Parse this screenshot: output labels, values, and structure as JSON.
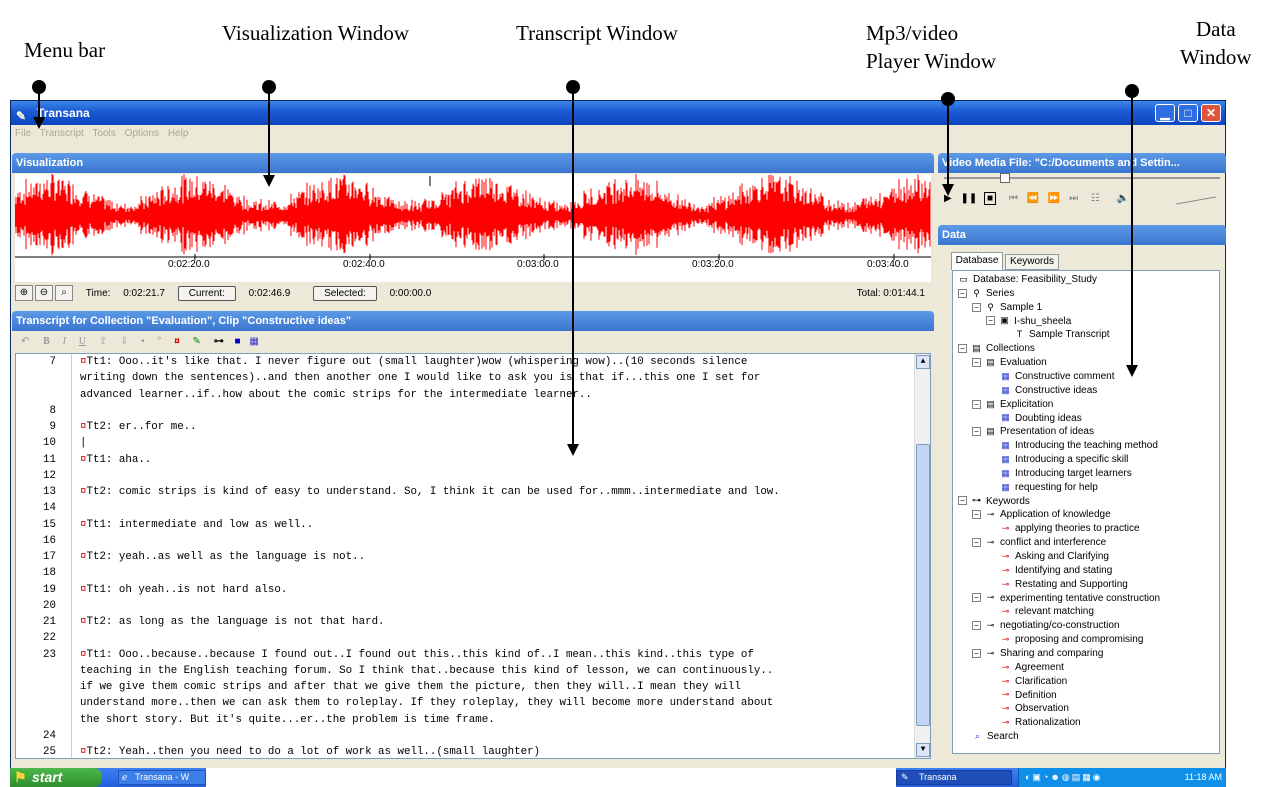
{
  "callouts": {
    "menu_bar": "Menu bar",
    "visualization_window": "Visualization Window",
    "transcript_window": "Transcript Window",
    "player_line1": "Mp3/video",
    "player_line2": "Player Window",
    "data_line1": "Data",
    "data_line2": "Window"
  },
  "app": {
    "title": "Transana",
    "menu": [
      "File",
      "Transcript",
      "Tools",
      "Options",
      "Help"
    ]
  },
  "visualization": {
    "header": "Visualization",
    "waveform_color": "#ff0000",
    "ticks": [
      "0:02:20.0",
      "0:02:40.0",
      "0:03:00.0",
      "0:03:20.0",
      "0:03:40.0"
    ],
    "time_label": "Time:",
    "time_value": "0:02:21.7",
    "current_btn": "Current:",
    "current_value": "0:02:46.9",
    "selected_btn": "Selected:",
    "selected_value": "0:00:00.0",
    "total": "Total:  0:01:44.1"
  },
  "video": {
    "header": "Video Media File: \"C:/Documents and Settin..."
  },
  "transcript": {
    "header": "Transcript for Collection \"Evaluation\", Clip \"Constructive ideas\"",
    "lines": [
      {
        "n": "7",
        "m": "¤",
        "t": "Tt1: Ooo..it's like that. I never figure out (small laughter)wow (whispering wow)..(10 seconds silence"
      },
      {
        "n": "",
        "m": "",
        "t": "writing down the sentences)..and then another one I would like to ask you is that if...this one I set for"
      },
      {
        "n": "",
        "m": "",
        "t": "advanced learner..if..how about the comic strips for the intermediate learner.."
      },
      {
        "n": "8",
        "m": "",
        "t": ""
      },
      {
        "n": "9",
        "m": "¤",
        "t": "Tt2: er..for me.."
      },
      {
        "n": "10",
        "m": "",
        "t": "|"
      },
      {
        "n": "11",
        "m": "¤",
        "t": "Tt1: aha.."
      },
      {
        "n": "12",
        "m": "",
        "t": ""
      },
      {
        "n": "13",
        "m": "¤",
        "t": "Tt2: comic strips is kind of easy to understand. So, I think it can be used for..mmm..intermediate and low."
      },
      {
        "n": "14",
        "m": "",
        "t": ""
      },
      {
        "n": "15",
        "m": "¤",
        "t": "Tt1: intermediate and low as well.."
      },
      {
        "n": "16",
        "m": "",
        "t": ""
      },
      {
        "n": "17",
        "m": "¤",
        "t": "Tt2: yeah..as well as the language is not.."
      },
      {
        "n": "18",
        "m": "",
        "t": ""
      },
      {
        "n": "19",
        "m": "¤",
        "t": "Tt1: oh yeah..is not hard also."
      },
      {
        "n": "20",
        "m": "",
        "t": ""
      },
      {
        "n": "21",
        "m": "¤",
        "t": "Tt2: as long as the language is not that hard."
      },
      {
        "n": "22",
        "m": "",
        "t": ""
      },
      {
        "n": "23",
        "m": "¤",
        "t": "Tt1: Ooo..because..because I found out..I found out this..this kind of..I mean..this kind..this type of"
      },
      {
        "n": "",
        "m": "",
        "t": "teaching in the English teaching forum. So I think that..because this kind of lesson, we can continuously.."
      },
      {
        "n": "",
        "m": "",
        "t": "if we give them comic strips and after that we give them the picture, then they will..I mean they will"
      },
      {
        "n": "",
        "m": "",
        "t": "understand more..then we can ask them to roleplay. If they roleplay, they will become more understand about"
      },
      {
        "n": "",
        "m": "",
        "t": "the short story. But it's quite...er..the problem is time frame."
      },
      {
        "n": "24",
        "m": "",
        "t": ""
      },
      {
        "n": "25",
        "m": "¤",
        "t": "Tt2: Yeah..then you need to do a lot of work as well..(small laughter)"
      }
    ]
  },
  "data": {
    "header": "Data",
    "tabs": [
      "Database",
      "Keywords"
    ],
    "tree": [
      {
        "l": 0,
        "icon": "db",
        "t": "Database: Feasibility_Study"
      },
      {
        "l": 1,
        "icon": "series",
        "t": "Series",
        "toggle": "-"
      },
      {
        "l": 2,
        "icon": "series",
        "t": "Sample 1",
        "toggle": "-"
      },
      {
        "l": 3,
        "icon": "episode",
        "t": "I-shu_sheela",
        "toggle": "-"
      },
      {
        "l": 4,
        "icon": "transcript",
        "t": "Sample Transcript"
      },
      {
        "l": 1,
        "icon": "collection",
        "t": "Collections",
        "toggle": "-"
      },
      {
        "l": 2,
        "icon": "collection",
        "t": "Evaluation",
        "toggle": "-"
      },
      {
        "l": 3,
        "icon": "clip",
        "t": "Constructive comment"
      },
      {
        "l": 3,
        "icon": "clip",
        "t": "Constructive ideas"
      },
      {
        "l": 2,
        "icon": "collection",
        "t": "Explicitation",
        "toggle": "-"
      },
      {
        "l": 3,
        "icon": "clip",
        "t": "Doubting ideas"
      },
      {
        "l": 2,
        "icon": "collection",
        "t": "Presentation of  ideas",
        "toggle": "-"
      },
      {
        "l": 3,
        "icon": "clip",
        "t": "Introducing the  teaching method"
      },
      {
        "l": 3,
        "icon": "clip",
        "t": "Introducing a specific skill"
      },
      {
        "l": 3,
        "icon": "clip",
        "t": "Introducing target learners"
      },
      {
        "l": 3,
        "icon": "clip",
        "t": "requesting for help"
      },
      {
        "l": 1,
        "icon": "keyroot",
        "t": "Keywords",
        "toggle": "-"
      },
      {
        "l": 2,
        "icon": "keygroup",
        "t": "Application of knowledge",
        "toggle": "-"
      },
      {
        "l": 3,
        "icon": "key",
        "t": "applying theories to practice"
      },
      {
        "l": 2,
        "icon": "keygroup",
        "t": "conflict and interference",
        "toggle": "-"
      },
      {
        "l": 3,
        "icon": "key",
        "t": "Asking and Clarifying"
      },
      {
        "l": 3,
        "icon": "key",
        "t": "Identifying and stating"
      },
      {
        "l": 3,
        "icon": "key",
        "t": "Restating and Supporting"
      },
      {
        "l": 2,
        "icon": "keygroup",
        "t": "experimenting tentative construction",
        "toggle": "-"
      },
      {
        "l": 3,
        "icon": "key",
        "t": "relevant matching"
      },
      {
        "l": 2,
        "icon": "keygroup",
        "t": "negotiating/co-construction",
        "toggle": "-"
      },
      {
        "l": 3,
        "icon": "key",
        "t": "proposing and compromising"
      },
      {
        "l": 2,
        "icon": "keygroup",
        "t": "Sharing and comparing",
        "toggle": "-"
      },
      {
        "l": 3,
        "icon": "key",
        "t": "Agreement"
      },
      {
        "l": 3,
        "icon": "key",
        "t": "Clarification"
      },
      {
        "l": 3,
        "icon": "key",
        "t": "Definition"
      },
      {
        "l": 3,
        "icon": "key",
        "t": "Observation"
      },
      {
        "l": 3,
        "icon": "key",
        "t": "Rationalization"
      },
      {
        "l": 1,
        "icon": "search",
        "t": "Search"
      }
    ]
  },
  "taskbar": {
    "start": "start",
    "task1": "Transana - W",
    "task2": "Transana",
    "clock": "11:18 AM"
  }
}
